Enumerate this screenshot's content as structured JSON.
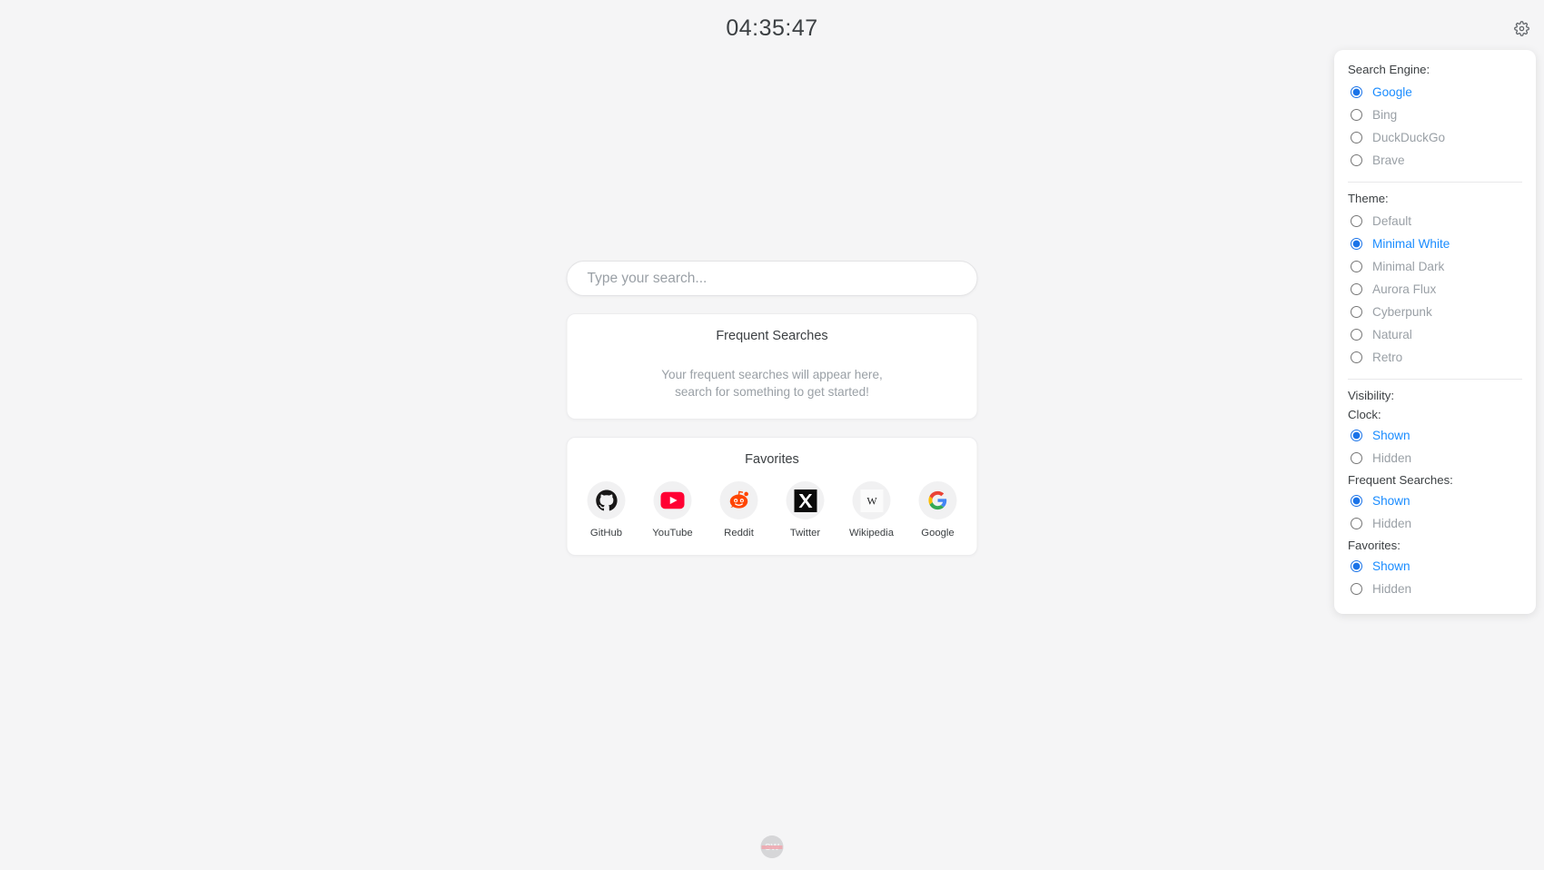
{
  "clock": {
    "time": "04:35:47"
  },
  "header": {
    "settings_icon": "gear-icon"
  },
  "search": {
    "placeholder": "Type your search...",
    "value": ""
  },
  "frequent": {
    "title": "Frequent Searches",
    "empty_line1": "Your frequent searches will appear here,",
    "empty_line2": "search for something to get started!"
  },
  "favorites": {
    "title": "Favorites",
    "items": [
      {
        "label": "GitHub",
        "icon": "github-icon"
      },
      {
        "label": "YouTube",
        "icon": "youtube-icon"
      },
      {
        "label": "Reddit",
        "icon": "reddit-icon"
      },
      {
        "label": "Twitter",
        "icon": "twitter-x-icon"
      },
      {
        "label": "Wikipedia",
        "icon": "wikipedia-icon"
      },
      {
        "label": "Google",
        "icon": "google-icon"
      }
    ]
  },
  "footer": {
    "logo_text": "SW"
  },
  "settings": {
    "search_engine": {
      "label": "Search Engine:",
      "selected": "Google",
      "options": [
        "Google",
        "Bing",
        "DuckDuckGo",
        "Brave"
      ]
    },
    "theme": {
      "label": "Theme:",
      "selected": "Minimal White",
      "options": [
        "Default",
        "Minimal White",
        "Minimal Dark",
        "Aurora Flux",
        "Cyberpunk",
        "Natural",
        "Retro"
      ]
    },
    "visibility": {
      "label": "Visibility:",
      "groups": [
        {
          "label": "Clock:",
          "selected": "Shown",
          "options": [
            "Shown",
            "Hidden"
          ]
        },
        {
          "label": "Frequent Searches:",
          "selected": "Shown",
          "options": [
            "Shown",
            "Hidden"
          ]
        },
        {
          "label": "Favorites:",
          "selected": "Shown",
          "options": [
            "Shown",
            "Hidden"
          ]
        }
      ]
    }
  },
  "colors": {
    "accent": "#1a8cff",
    "radio_accent": "#1a73e8",
    "background": "#f5f5f6",
    "card": "#ffffff",
    "muted_text": "#9aa0a6",
    "primary_text": "#3c4043"
  }
}
